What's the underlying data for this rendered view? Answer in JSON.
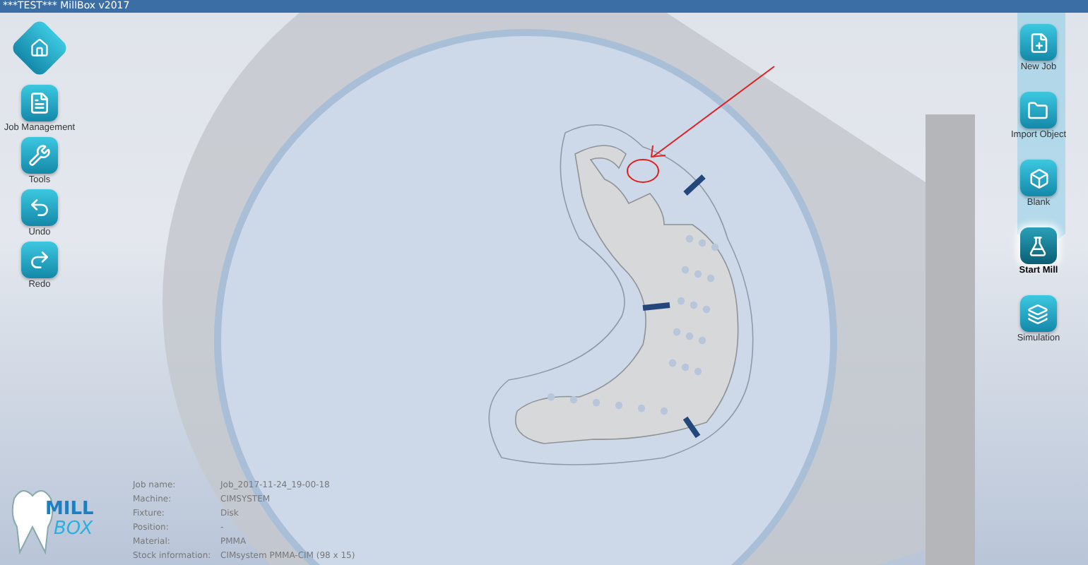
{
  "window": {
    "title": "***TEST*** MillBox v2017"
  },
  "left_toolbar": [
    {
      "kind": "home"
    },
    {
      "kind": "job",
      "label": "Job Management"
    },
    {
      "kind": "tools",
      "label": "Tools"
    },
    {
      "kind": "undo",
      "label": "Undo"
    },
    {
      "kind": "redo",
      "label": "Redo"
    }
  ],
  "right_toolbar": [
    {
      "kind": "new",
      "label": "New Job",
      "selected": false
    },
    {
      "kind": "import",
      "label": "Import Object",
      "selected": false
    },
    {
      "kind": "blank",
      "label": "Blank",
      "selected": false
    },
    {
      "kind": "mill",
      "label": "Start Mill",
      "selected": true
    },
    {
      "kind": "simulation",
      "label": "Simulation",
      "selected": false
    }
  ],
  "logo": {
    "top": "MILL",
    "bottom": "BOX"
  },
  "job_info": [
    {
      "label": "Job name:",
      "value": "Job_2017-11-24_19-00-18"
    },
    {
      "label": "Machine:",
      "value": "CIMSYSTEM"
    },
    {
      "label": "Fixture:",
      "value": "Disk"
    },
    {
      "label": "Position:",
      "value": "-"
    },
    {
      "label": "Material:",
      "value": "PMMA"
    },
    {
      "label": "Stock information:",
      "value": "CIMsystem PMMA-CIM (98 x 15)"
    }
  ]
}
